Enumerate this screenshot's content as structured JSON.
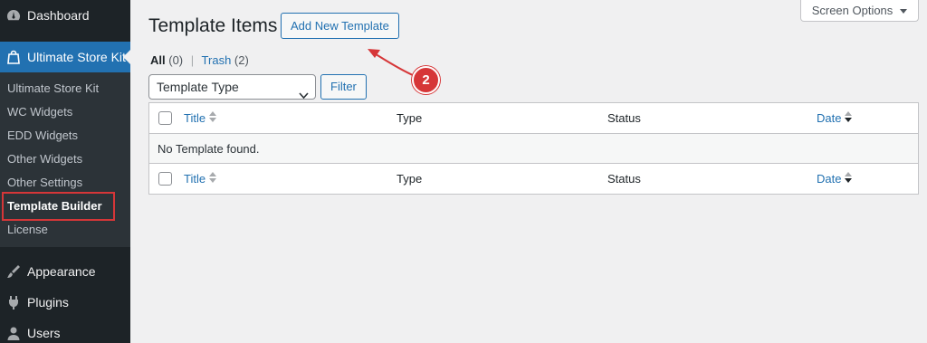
{
  "sidebar": {
    "dashboard": {
      "label": "Dashboard",
      "icon": "dashboard-icon"
    },
    "store_kit": {
      "label": "Ultimate Store Kit",
      "icon": "shopping-bag-icon"
    },
    "submenu": [
      {
        "label": "Ultimate Store Kit"
      },
      {
        "label": "WC Widgets"
      },
      {
        "label": "EDD Widgets"
      },
      {
        "label": "Other Widgets"
      },
      {
        "label": "Other Settings"
      },
      {
        "label": "Template Builder"
      },
      {
        "label": "License"
      }
    ],
    "appearance": {
      "label": "Appearance",
      "icon": "paintbrush-icon"
    },
    "plugins": {
      "label": "Plugins",
      "icon": "plugin-icon"
    },
    "users": {
      "label": "Users",
      "icon": "user-icon"
    }
  },
  "header": {
    "screen_options": "Screen Options",
    "title": "Template Items",
    "add_new": "Add New Template"
  },
  "views": {
    "all_label": "All",
    "all_count": "(0)",
    "separator": "|",
    "trash_label": "Trash",
    "trash_count": "(2)"
  },
  "filters": {
    "template_type": "Template Type",
    "filter_button": "Filter"
  },
  "table": {
    "columns": {
      "title": "Title",
      "type": "Type",
      "status": "Status",
      "date": "Date"
    },
    "empty_message": "No Template found."
  },
  "annotation": {
    "step": "2",
    "color": "#d63638"
  },
  "colors": {
    "accent": "#2271b1",
    "sidebar_bg": "#1d2327",
    "highlight": "#d63638"
  }
}
